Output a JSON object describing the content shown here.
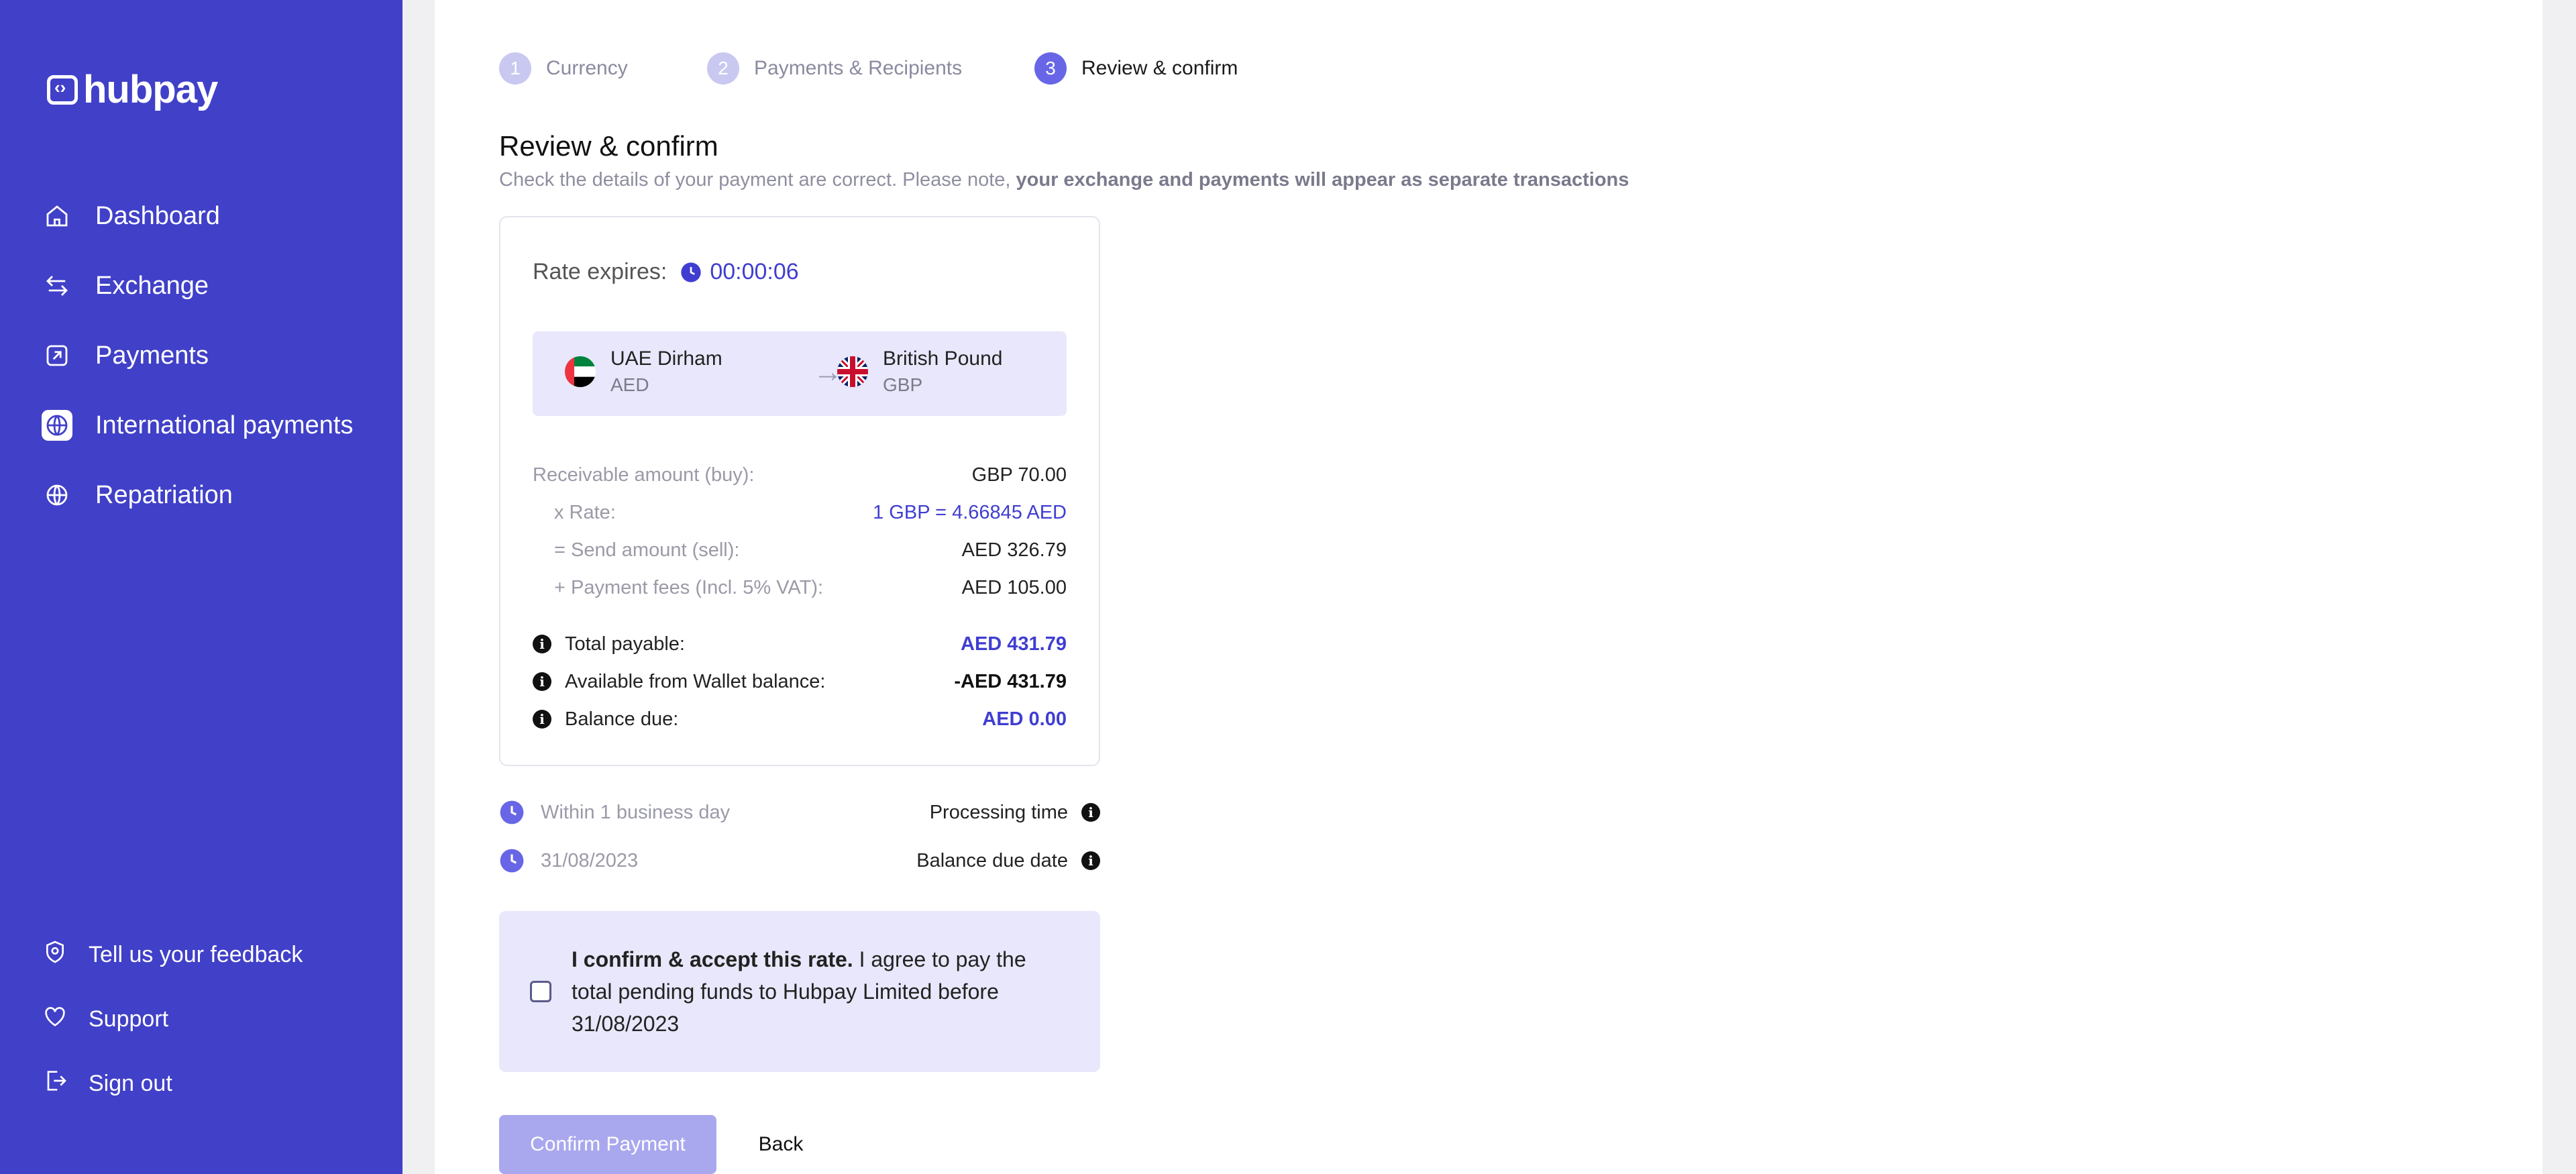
{
  "brand": {
    "name": "hubpay",
    "sidebar_color": "#4140c8",
    "accent": "#3f3ed0"
  },
  "sidebar": {
    "items": [
      {
        "label": "Dashboard",
        "icon": "home-icon"
      },
      {
        "label": "Exchange",
        "icon": "exchange-icon"
      },
      {
        "label": "Payments",
        "icon": "payment-icon"
      },
      {
        "label": "International payments",
        "icon": "globe-icon",
        "active": true
      },
      {
        "label": "Repatriation",
        "icon": "globe-icon"
      }
    ],
    "footer": [
      {
        "label": "Tell us your feedback",
        "icon": "feedback-icon"
      },
      {
        "label": "Support",
        "icon": "heart-icon"
      },
      {
        "label": "Sign out",
        "icon": "sign-out-icon"
      }
    ]
  },
  "stepper": [
    {
      "num": "1",
      "label": "Currency"
    },
    {
      "num": "2",
      "label": "Payments & Recipients"
    },
    {
      "num": "3",
      "label": "Review & confirm",
      "active": true
    }
  ],
  "page": {
    "title": "Review & confirm",
    "subtitle_plain": "Check the details of your payment are correct. Please note, ",
    "subtitle_bold": "your exchange and payments will appear as separate transactions"
  },
  "rate": {
    "label": "Rate expires:",
    "timer": "00:00:06"
  },
  "exchange": {
    "from": {
      "name": "UAE Dirham",
      "code": "AED",
      "flag": "uae-flag-icon"
    },
    "to": {
      "name": "British Pound",
      "code": "GBP",
      "flag": "uk-flag-icon"
    }
  },
  "summary": {
    "receivable_label": "Receivable amount (buy):",
    "receivable_value": "GBP 70.00",
    "rate_label": "x Rate:",
    "rate_value": "1 GBP = 4.66845 AED",
    "send_label": "= Send amount (sell):",
    "send_value": "AED 326.79",
    "fees_label": "+ Payment fees (Incl. 5% VAT):",
    "fees_value": "AED 105.00"
  },
  "totals": {
    "total_label": "Total payable:",
    "total_value": "AED 431.79",
    "wallet_label": "Available from Wallet balance:",
    "wallet_value": "-AED 431.79",
    "due_label": "Balance due:",
    "due_value": "AED 0.00"
  },
  "meta": {
    "processing_value": "Within 1 business day",
    "processing_label": "Processing time",
    "due_date_value": "31/08/2023",
    "due_date_label": "Balance due date"
  },
  "confirm": {
    "bold": "I confirm & accept this rate.",
    "text": " I agree to pay the total pending funds to Hubpay Limited before 31/08/2023"
  },
  "buttons": {
    "confirm": "Confirm Payment",
    "back": "Back"
  }
}
